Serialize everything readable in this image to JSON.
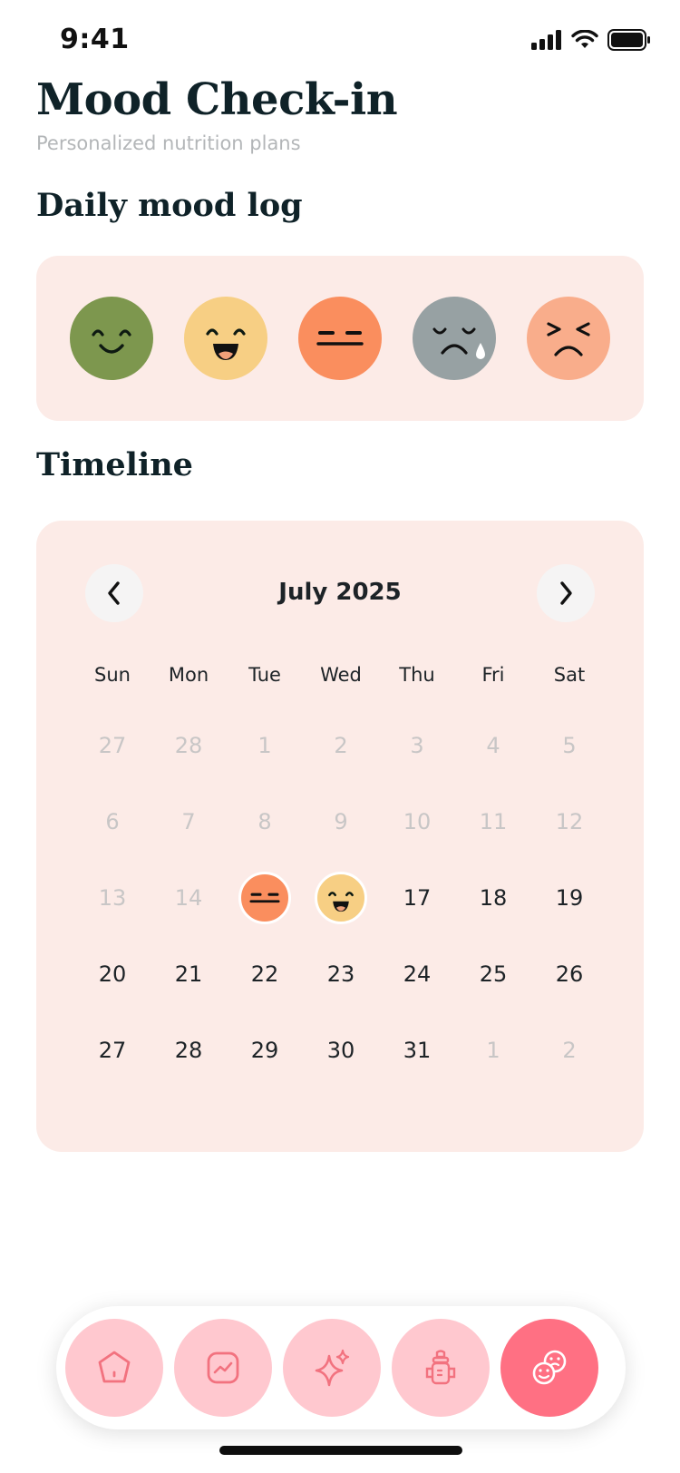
{
  "status": {
    "time": "9:41",
    "icons": [
      "signal-icon",
      "wifi-icon",
      "battery-icon"
    ]
  },
  "header": {
    "title": "Mood Check-in",
    "subtitle": "Personalized nutrition plans"
  },
  "mood_section": {
    "title": "Daily mood log",
    "moods": [
      {
        "name": "content",
        "color": "#7d974e"
      },
      {
        "name": "happy",
        "color": "#f7cf84"
      },
      {
        "name": "neutral",
        "color": "#fa8e5e"
      },
      {
        "name": "sad",
        "color": "#97a1a3"
      },
      {
        "name": "angry",
        "color": "#f9ad8b"
      }
    ]
  },
  "timeline": {
    "title": "Timeline",
    "month": "July 2025",
    "weekdays": [
      "Sun",
      "Mon",
      "Tue",
      "Wed",
      "Thu",
      "Fri",
      "Sat"
    ],
    "weeks": [
      [
        {
          "d": "27",
          "muted": true
        },
        {
          "d": "28",
          "muted": true
        },
        {
          "d": "1",
          "muted": true
        },
        {
          "d": "2",
          "muted": true
        },
        {
          "d": "3",
          "muted": true
        },
        {
          "d": "4",
          "muted": true
        },
        {
          "d": "5",
          "muted": true
        }
      ],
      [
        {
          "d": "6",
          "muted": true
        },
        {
          "d": "7",
          "muted": true
        },
        {
          "d": "8",
          "muted": true
        },
        {
          "d": "9",
          "muted": true
        },
        {
          "d": "10",
          "muted": true
        },
        {
          "d": "11",
          "muted": true
        },
        {
          "d": "12",
          "muted": true
        }
      ],
      [
        {
          "d": "13",
          "muted": true
        },
        {
          "d": "14",
          "muted": true
        },
        {
          "d": "15",
          "mood": "neutral"
        },
        {
          "d": "16",
          "mood": "happy"
        },
        {
          "d": "17"
        },
        {
          "d": "18"
        },
        {
          "d": "19"
        }
      ],
      [
        {
          "d": "20"
        },
        {
          "d": "21"
        },
        {
          "d": "22"
        },
        {
          "d": "23"
        },
        {
          "d": "24"
        },
        {
          "d": "25"
        },
        {
          "d": "26"
        }
      ],
      [
        {
          "d": "27"
        },
        {
          "d": "28"
        },
        {
          "d": "29"
        },
        {
          "d": "30"
        },
        {
          "d": "31"
        },
        {
          "d": "1",
          "muted": true
        },
        {
          "d": "2",
          "muted": true
        }
      ]
    ]
  },
  "tabbar": {
    "tabs": [
      {
        "name": "home",
        "icon": "home-icon",
        "active": false
      },
      {
        "name": "trends",
        "icon": "chart-icon",
        "active": false
      },
      {
        "name": "sparkle",
        "icon": "sparkle-icon",
        "active": false
      },
      {
        "name": "baby-bottle",
        "icon": "baby-bottle-icon",
        "active": false
      },
      {
        "name": "mood",
        "icon": "mood-faces-icon",
        "active": true
      }
    ],
    "colors": {
      "inactive": "#ffc8cf",
      "active": "#ff7083",
      "icon_inactive": "#f2727f",
      "icon_active": "#ffffff"
    }
  }
}
